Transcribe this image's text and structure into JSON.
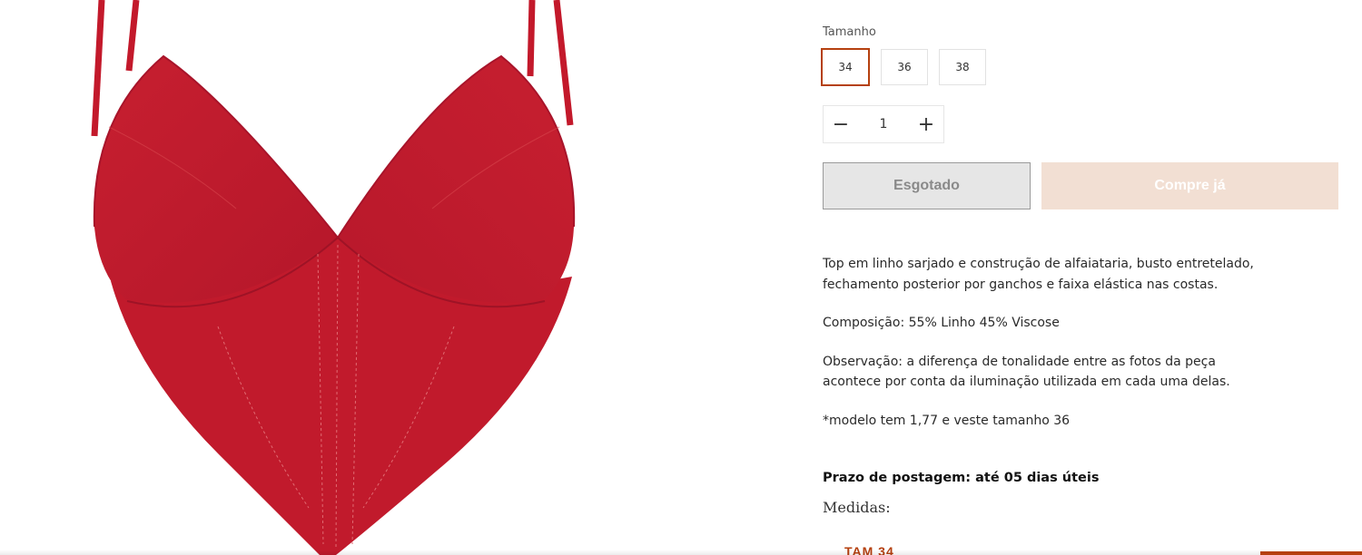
{
  "product": {
    "size_label": "Tamanho",
    "sizes": [
      "34",
      "36",
      "38"
    ],
    "selected_size": "34",
    "quantity": "1",
    "quantity_decrease_icon": "minus-icon",
    "quantity_increase_icon": "plus-icon",
    "soldout_label": "Esgotado",
    "buy_label": "Compre já",
    "description": "Top em linho sarjado e construção de alfaiataria, busto entretelado, fechamento posterior por ganchos e faixa elástica nas costas.",
    "composition": "Composição: 55% Linho 45% Viscose",
    "observation": "Observação: a diferença de tonalidade entre as fotos da peça acontece por conta da iluminação utilizada em cada uma delas.",
    "model_note": "*modelo tem 1,77 e veste tamanho 36",
    "shipping_deadline": "Prazo de postagem: até 05 dias úteis",
    "measures_label": "Medidas:",
    "size_table_heading": "TAM 34"
  },
  "colors": {
    "accent": "#b5400f",
    "buy_button_bg": "#f2dfd3",
    "soldout_bg": "#e6e6e6",
    "product_red": "#c01b2b"
  }
}
